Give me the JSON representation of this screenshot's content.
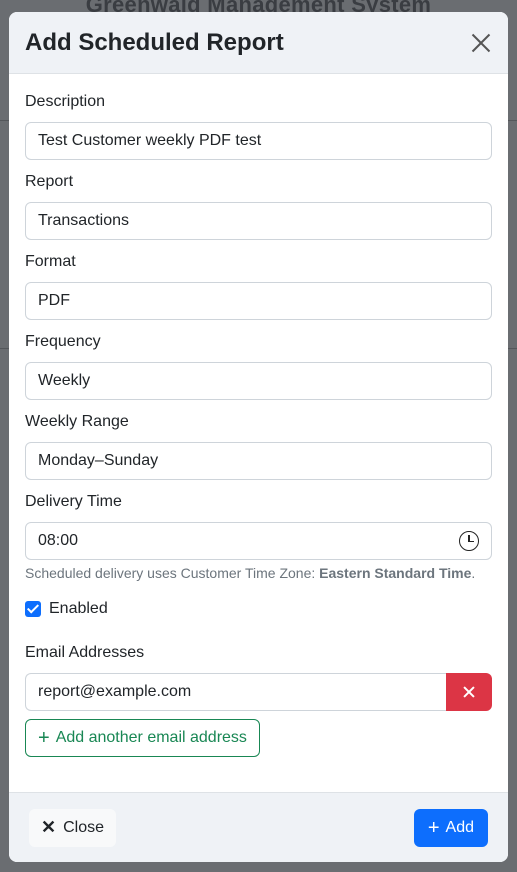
{
  "background": {
    "app_title": "Greenwald Management System"
  },
  "modal": {
    "title": "Add Scheduled Report",
    "fields": {
      "description": {
        "label": "Description",
        "value": "Test Customer weekly PDF test"
      },
      "report": {
        "label": "Report",
        "value": "Transactions"
      },
      "format": {
        "label": "Format",
        "value": "PDF"
      },
      "frequency": {
        "label": "Frequency",
        "value": "Weekly"
      },
      "weekly_range": {
        "label": "Weekly Range",
        "value": "Monday–Sunday"
      },
      "delivery_time": {
        "label": "Delivery Time",
        "value": "08:00"
      }
    },
    "help": {
      "prefix": "Scheduled delivery uses Customer Time Zone: ",
      "tz": "Eastern Standard Time",
      "suffix": "."
    },
    "enabled": {
      "label": "Enabled",
      "checked": true
    },
    "emails": {
      "label": "Email Addresses",
      "items": [
        "report@example.com"
      ],
      "add_label": "Add another email address"
    },
    "footer": {
      "close_label": "Close",
      "add_label": "Add"
    }
  },
  "colors": {
    "primary": "#0d6efd",
    "danger": "#dc3545",
    "success": "#198754"
  },
  "icons": {
    "close": "close-icon",
    "clock": "clock-icon",
    "delete": "x-icon",
    "plus": "plus-icon"
  }
}
